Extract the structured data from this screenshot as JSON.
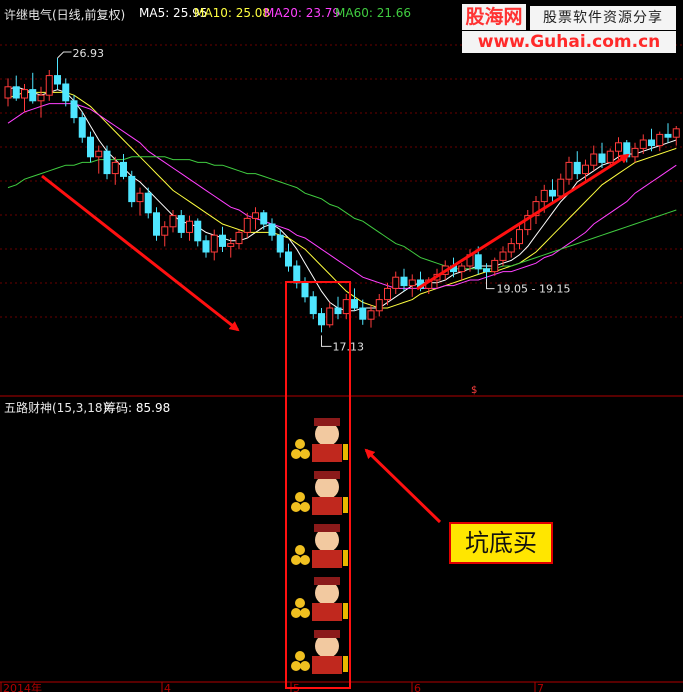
{
  "header": {
    "stock": "许继电气(日线,前复权)",
    "ma5": "MA5: 25.95",
    "ma10": "MA10: 25.08",
    "ma20": "MA20: 23.79",
    "ma60": "MA60: 21.66"
  },
  "indicator": {
    "name": "五路财神(15,3,18)",
    "chip": "筹码: 85.98"
  },
  "logo": {
    "site": "股海网",
    "slogan": "股票软件资源分享",
    "url": "www.Guhai.com.cn"
  },
  "callout": {
    "text": "坑底买"
  },
  "colors": {
    "up": "#ff3b3b",
    "down": "#4fe6ff",
    "ma5": "#ffffff",
    "ma10": "#ffff40",
    "ma20": "#ff40ff",
    "ma60": "#40cc40",
    "axis": "#b00000",
    "arrow": "#ff1010"
  },
  "chart_data": {
    "type": "candlestick",
    "title": "许继电气(日线,前复权)",
    "price_range": [
      15.0,
      28.0
    ],
    "x_labels": [
      "2014年",
      "4",
      "5",
      "6",
      "7"
    ],
    "annotations": {
      "high": "26.93",
      "low": "17.13",
      "range": "19.05 - 19.15",
      "marker": "$"
    },
    "candles_ohlc": [
      [
        25.5,
        26.2,
        25.2,
        25.9
      ],
      [
        25.9,
        26.3,
        25.4,
        25.5
      ],
      [
        25.5,
        26.0,
        25.0,
        25.8
      ],
      [
        25.8,
        26.4,
        25.3,
        25.4
      ],
      [
        25.4,
        25.9,
        24.8,
        25.6
      ],
      [
        25.6,
        26.5,
        25.4,
        26.3
      ],
      [
        26.3,
        26.93,
        25.8,
        26.0
      ],
      [
        26.0,
        26.2,
        25.2,
        25.4
      ],
      [
        25.4,
        25.6,
        24.6,
        24.8
      ],
      [
        24.8,
        25.0,
        23.9,
        24.1
      ],
      [
        24.1,
        24.3,
        23.2,
        23.4
      ],
      [
        23.4,
        23.8,
        22.8,
        23.6
      ],
      [
        23.6,
        23.8,
        22.6,
        22.8
      ],
      [
        22.8,
        23.4,
        22.4,
        23.2
      ],
      [
        23.2,
        23.5,
        22.6,
        22.7
      ],
      [
        22.7,
        22.9,
        21.6,
        21.8
      ],
      [
        21.8,
        22.3,
        21.3,
        22.1
      ],
      [
        22.1,
        22.3,
        21.2,
        21.4
      ],
      [
        21.4,
        21.6,
        20.4,
        20.6
      ],
      [
        20.6,
        21.1,
        20.2,
        20.9
      ],
      [
        20.9,
        21.5,
        20.7,
        21.3
      ],
      [
        21.3,
        21.5,
        20.5,
        20.7
      ],
      [
        20.7,
        21.3,
        20.4,
        21.1
      ],
      [
        21.1,
        21.2,
        20.2,
        20.4
      ],
      [
        20.4,
        20.6,
        19.8,
        20.0
      ],
      [
        20.0,
        20.8,
        19.7,
        20.6
      ],
      [
        20.6,
        20.9,
        20.0,
        20.2
      ],
      [
        20.2,
        20.5,
        19.8,
        20.3
      ],
      [
        20.3,
        20.8,
        20.1,
        20.7
      ],
      [
        20.7,
        21.4,
        20.5,
        21.2
      ],
      [
        21.2,
        21.6,
        20.8,
        21.4
      ],
      [
        21.4,
        21.5,
        20.8,
        21.0
      ],
      [
        21.0,
        21.2,
        20.4,
        20.6
      ],
      [
        20.6,
        20.8,
        19.8,
        20.0
      ],
      [
        20.0,
        20.3,
        19.3,
        19.5
      ],
      [
        19.5,
        19.7,
        18.7,
        18.9
      ],
      [
        18.9,
        19.1,
        18.2,
        18.4
      ],
      [
        18.4,
        18.6,
        17.6,
        17.8
      ],
      [
        17.8,
        18.0,
        17.13,
        17.4
      ],
      [
        17.4,
        18.2,
        17.3,
        18.0
      ],
      [
        18.0,
        18.4,
        17.6,
        17.8
      ],
      [
        17.8,
        18.5,
        17.6,
        18.3
      ],
      [
        18.3,
        18.7,
        17.9,
        18.0
      ],
      [
        18.0,
        18.3,
        17.4,
        17.6
      ],
      [
        17.6,
        18.1,
        17.3,
        17.9
      ],
      [
        17.9,
        18.5,
        17.7,
        18.3
      ],
      [
        18.3,
        18.9,
        18.1,
        18.7
      ],
      [
        18.7,
        19.3,
        18.5,
        19.1
      ],
      [
        19.1,
        19.4,
        18.6,
        18.8
      ],
      [
        18.8,
        19.2,
        18.4,
        19.0
      ],
      [
        19.0,
        19.3,
        18.6,
        18.7
      ],
      [
        18.7,
        19.1,
        18.5,
        19.0
      ],
      [
        19.0,
        19.4,
        18.7,
        19.2
      ],
      [
        19.2,
        19.7,
        19.0,
        19.5
      ],
      [
        19.5,
        19.8,
        19.1,
        19.3
      ],
      [
        19.3,
        19.6,
        19.0,
        19.5
      ],
      [
        19.5,
        20.1,
        19.3,
        19.9
      ],
      [
        19.9,
        20.2,
        19.2,
        19.4
      ],
      [
        19.4,
        19.6,
        19.05,
        19.3
      ],
      [
        19.3,
        19.8,
        19.15,
        19.7
      ],
      [
        19.7,
        20.2,
        19.5,
        20.0
      ],
      [
        20.0,
        20.5,
        19.8,
        20.3
      ],
      [
        20.3,
        21.0,
        20.1,
        20.8
      ],
      [
        20.8,
        21.5,
        20.6,
        21.3
      ],
      [
        21.3,
        22.0,
        21.0,
        21.8
      ],
      [
        21.8,
        22.4,
        21.4,
        22.2
      ],
      [
        22.2,
        22.6,
        21.8,
        22.0
      ],
      [
        22.0,
        22.8,
        21.9,
        22.6
      ],
      [
        22.6,
        23.4,
        22.4,
        23.2
      ],
      [
        23.2,
        23.6,
        22.6,
        22.8
      ],
      [
        22.8,
        23.3,
        22.5,
        23.1
      ],
      [
        23.1,
        23.8,
        22.9,
        23.5
      ],
      [
        23.5,
        23.9,
        23.0,
        23.2
      ],
      [
        23.2,
        23.7,
        23.0,
        23.6
      ],
      [
        23.6,
        24.1,
        23.3,
        23.9
      ],
      [
        23.9,
        24.0,
        23.2,
        23.4
      ],
      [
        23.4,
        23.9,
        23.2,
        23.7
      ],
      [
        23.7,
        24.2,
        23.5,
        24.0
      ],
      [
        24.0,
        24.4,
        23.6,
        23.8
      ],
      [
        23.8,
        24.3,
        23.6,
        24.2
      ],
      [
        24.2,
        24.6,
        23.9,
        24.1
      ],
      [
        24.1,
        24.5,
        23.8,
        24.4
      ]
    ],
    "moving_averages": [
      {
        "name": "MA5",
        "values": [
          25.8,
          25.9,
          25.8,
          25.7,
          25.6,
          25.7,
          25.8,
          25.7,
          25.4,
          25.0,
          24.5,
          24.0,
          23.6,
          23.3,
          23.0,
          22.7,
          22.5,
          22.2,
          21.9,
          21.6,
          21.3,
          21.1,
          21.0,
          20.9,
          20.7,
          20.6,
          20.5,
          20.4,
          20.4,
          20.5,
          20.7,
          20.9,
          21.0,
          20.8,
          20.5,
          20.1,
          19.6,
          19.1,
          18.6,
          18.2,
          18.0,
          17.9,
          17.9,
          18.0,
          18.0,
          18.0,
          18.2,
          18.4,
          18.6,
          18.8,
          18.9,
          18.9,
          18.9,
          19.0,
          19.2,
          19.3,
          19.4,
          19.5,
          19.5,
          19.5,
          19.6,
          19.7,
          19.9,
          20.2,
          20.6,
          21.0,
          21.4,
          21.8,
          22.1,
          22.5,
          22.7,
          22.9,
          23.1,
          23.2,
          23.4,
          23.5,
          23.5,
          23.6,
          23.7,
          23.8,
          23.9,
          24.0
        ]
      },
      {
        "name": "MA10",
        "values": [
          25.5,
          25.6,
          25.7,
          25.7,
          25.7,
          25.7,
          25.7,
          25.7,
          25.6,
          25.4,
          25.2,
          24.9,
          24.6,
          24.3,
          24.0,
          23.7,
          23.4,
          23.1,
          22.8,
          22.5,
          22.2,
          22.0,
          21.8,
          21.6,
          21.4,
          21.2,
          21.0,
          20.9,
          20.8,
          20.7,
          20.7,
          20.7,
          20.7,
          20.6,
          20.5,
          20.3,
          20.1,
          19.8,
          19.5,
          19.2,
          18.9,
          18.6,
          18.4,
          18.2,
          18.1,
          18.0,
          18.0,
          18.1,
          18.2,
          18.3,
          18.5,
          18.6,
          18.7,
          18.8,
          18.9,
          19.0,
          19.1,
          19.2,
          19.3,
          19.3,
          19.4,
          19.5,
          19.6,
          19.8,
          20.0,
          20.3,
          20.6,
          20.9,
          21.2,
          21.5,
          21.8,
          22.1,
          22.4,
          22.6,
          22.8,
          23.0,
          23.2,
          23.3,
          23.4,
          23.5,
          23.6,
          23.7
        ]
      },
      {
        "name": "MA20",
        "values": [
          24.6,
          24.8,
          25.0,
          25.1,
          25.2,
          25.3,
          25.3,
          25.3,
          25.3,
          25.2,
          25.1,
          24.9,
          24.7,
          24.5,
          24.3,
          24.1,
          23.9,
          23.6,
          23.4,
          23.2,
          23.0,
          22.8,
          22.6,
          22.4,
          22.2,
          22.0,
          21.8,
          21.6,
          21.5,
          21.3,
          21.2,
          21.1,
          21.0,
          20.9,
          20.8,
          20.6,
          20.5,
          20.3,
          20.1,
          19.9,
          19.7,
          19.5,
          19.3,
          19.1,
          19.0,
          18.9,
          18.8,
          18.7,
          18.7,
          18.7,
          18.7,
          18.7,
          18.7,
          18.8,
          18.8,
          18.9,
          19.0,
          19.0,
          19.1,
          19.2,
          19.3,
          19.3,
          19.4,
          19.5,
          19.6,
          19.8,
          19.9,
          20.1,
          20.3,
          20.5,
          20.7,
          21.0,
          21.2,
          21.4,
          21.6,
          21.8,
          22.1,
          22.3,
          22.5,
          22.7,
          22.9,
          23.1
        ]
      },
      {
        "name": "MA60",
        "values": [
          22.3,
          22.4,
          22.6,
          22.7,
          22.8,
          22.9,
          23.0,
          23.1,
          23.1,
          23.2,
          23.2,
          23.3,
          23.3,
          23.3,
          23.3,
          23.4,
          23.4,
          23.4,
          23.4,
          23.4,
          23.3,
          23.3,
          23.3,
          23.2,
          23.2,
          23.1,
          23.1,
          23.0,
          22.9,
          22.8,
          22.8,
          22.7,
          22.6,
          22.5,
          22.4,
          22.3,
          22.1,
          22.0,
          21.9,
          21.7,
          21.6,
          21.4,
          21.2,
          21.1,
          20.9,
          20.7,
          20.5,
          20.3,
          20.2,
          20.0,
          19.8,
          19.7,
          19.6,
          19.5,
          19.4,
          19.4,
          19.4,
          19.4,
          19.4,
          19.4,
          19.5,
          19.5,
          19.6,
          19.7,
          19.8,
          19.9,
          20.0,
          20.1,
          20.2,
          20.3,
          20.4,
          20.5,
          20.6,
          20.7,
          20.8,
          20.9,
          21.0,
          21.1,
          21.2,
          21.3,
          21.4,
          21.5
        ]
      }
    ],
    "signal_icons": 5
  }
}
